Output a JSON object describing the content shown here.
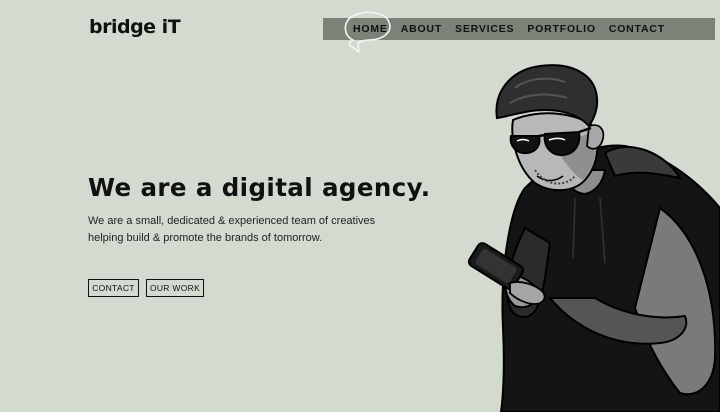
{
  "brand": {
    "logo_text": "bridge iT"
  },
  "nav": {
    "items": [
      {
        "label": "HOME",
        "active": true
      },
      {
        "label": "ABOUT"
      },
      {
        "label": "SERVICES"
      },
      {
        "label": "PORTFOLIO"
      },
      {
        "label": "CONTACT"
      }
    ]
  },
  "hero": {
    "title": "We are a digital agency.",
    "description": "We are a small, dedicated & experienced team of creatives helping build & promote the brands of tomorrow.",
    "buttons": {
      "contact": "CONTACT",
      "our_work": "OUR WORK"
    }
  },
  "colors": {
    "background": "#d3dbd0",
    "nav_bar": "#7b8278",
    "text": "#111111"
  },
  "illustration": {
    "icon": "man-with-phone-illustration"
  }
}
